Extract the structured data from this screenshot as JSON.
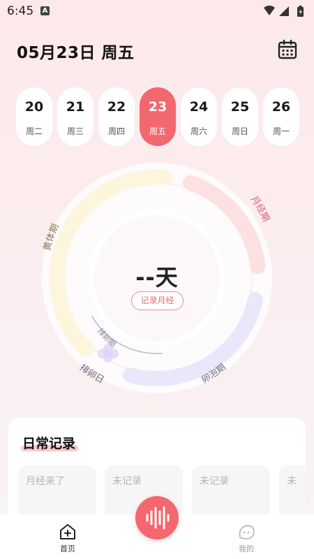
{
  "status_bar": {
    "time": "6:45",
    "notification_letter": "A"
  },
  "header": {
    "date_label": "05月23日 周五"
  },
  "week": {
    "days": [
      {
        "num": "20",
        "weekday": "周二",
        "active": false
      },
      {
        "num": "21",
        "weekday": "周三",
        "active": false
      },
      {
        "num": "22",
        "weekday": "周四",
        "active": false
      },
      {
        "num": "23",
        "weekday": "周五",
        "active": true
      },
      {
        "num": "24",
        "weekday": "周六",
        "active": false
      },
      {
        "num": "25",
        "weekday": "周日",
        "active": false
      },
      {
        "num": "26",
        "weekday": "周一",
        "active": false
      }
    ]
  },
  "cycle": {
    "phases": {
      "menstrual": "月经期",
      "follicular": "卵泡期",
      "ovulation_period": "排卵期",
      "ovulation_day": "排卵日",
      "luteal": "黄体期"
    },
    "center_value": "--天",
    "record_button": "记录月经"
  },
  "daily": {
    "title": "日常记录",
    "items": [
      "月经来了",
      "未记录",
      "未记录",
      "未"
    ]
  },
  "nav": {
    "home": "首页",
    "me": "我的"
  },
  "colors": {
    "accent": "#f3676e",
    "menstrual_arc": "#fde0e1",
    "follicular_arc": "#ebe7fb",
    "luteal_arc": "#fdf5dc",
    "ovulation_flower": "#e8dcfa"
  }
}
